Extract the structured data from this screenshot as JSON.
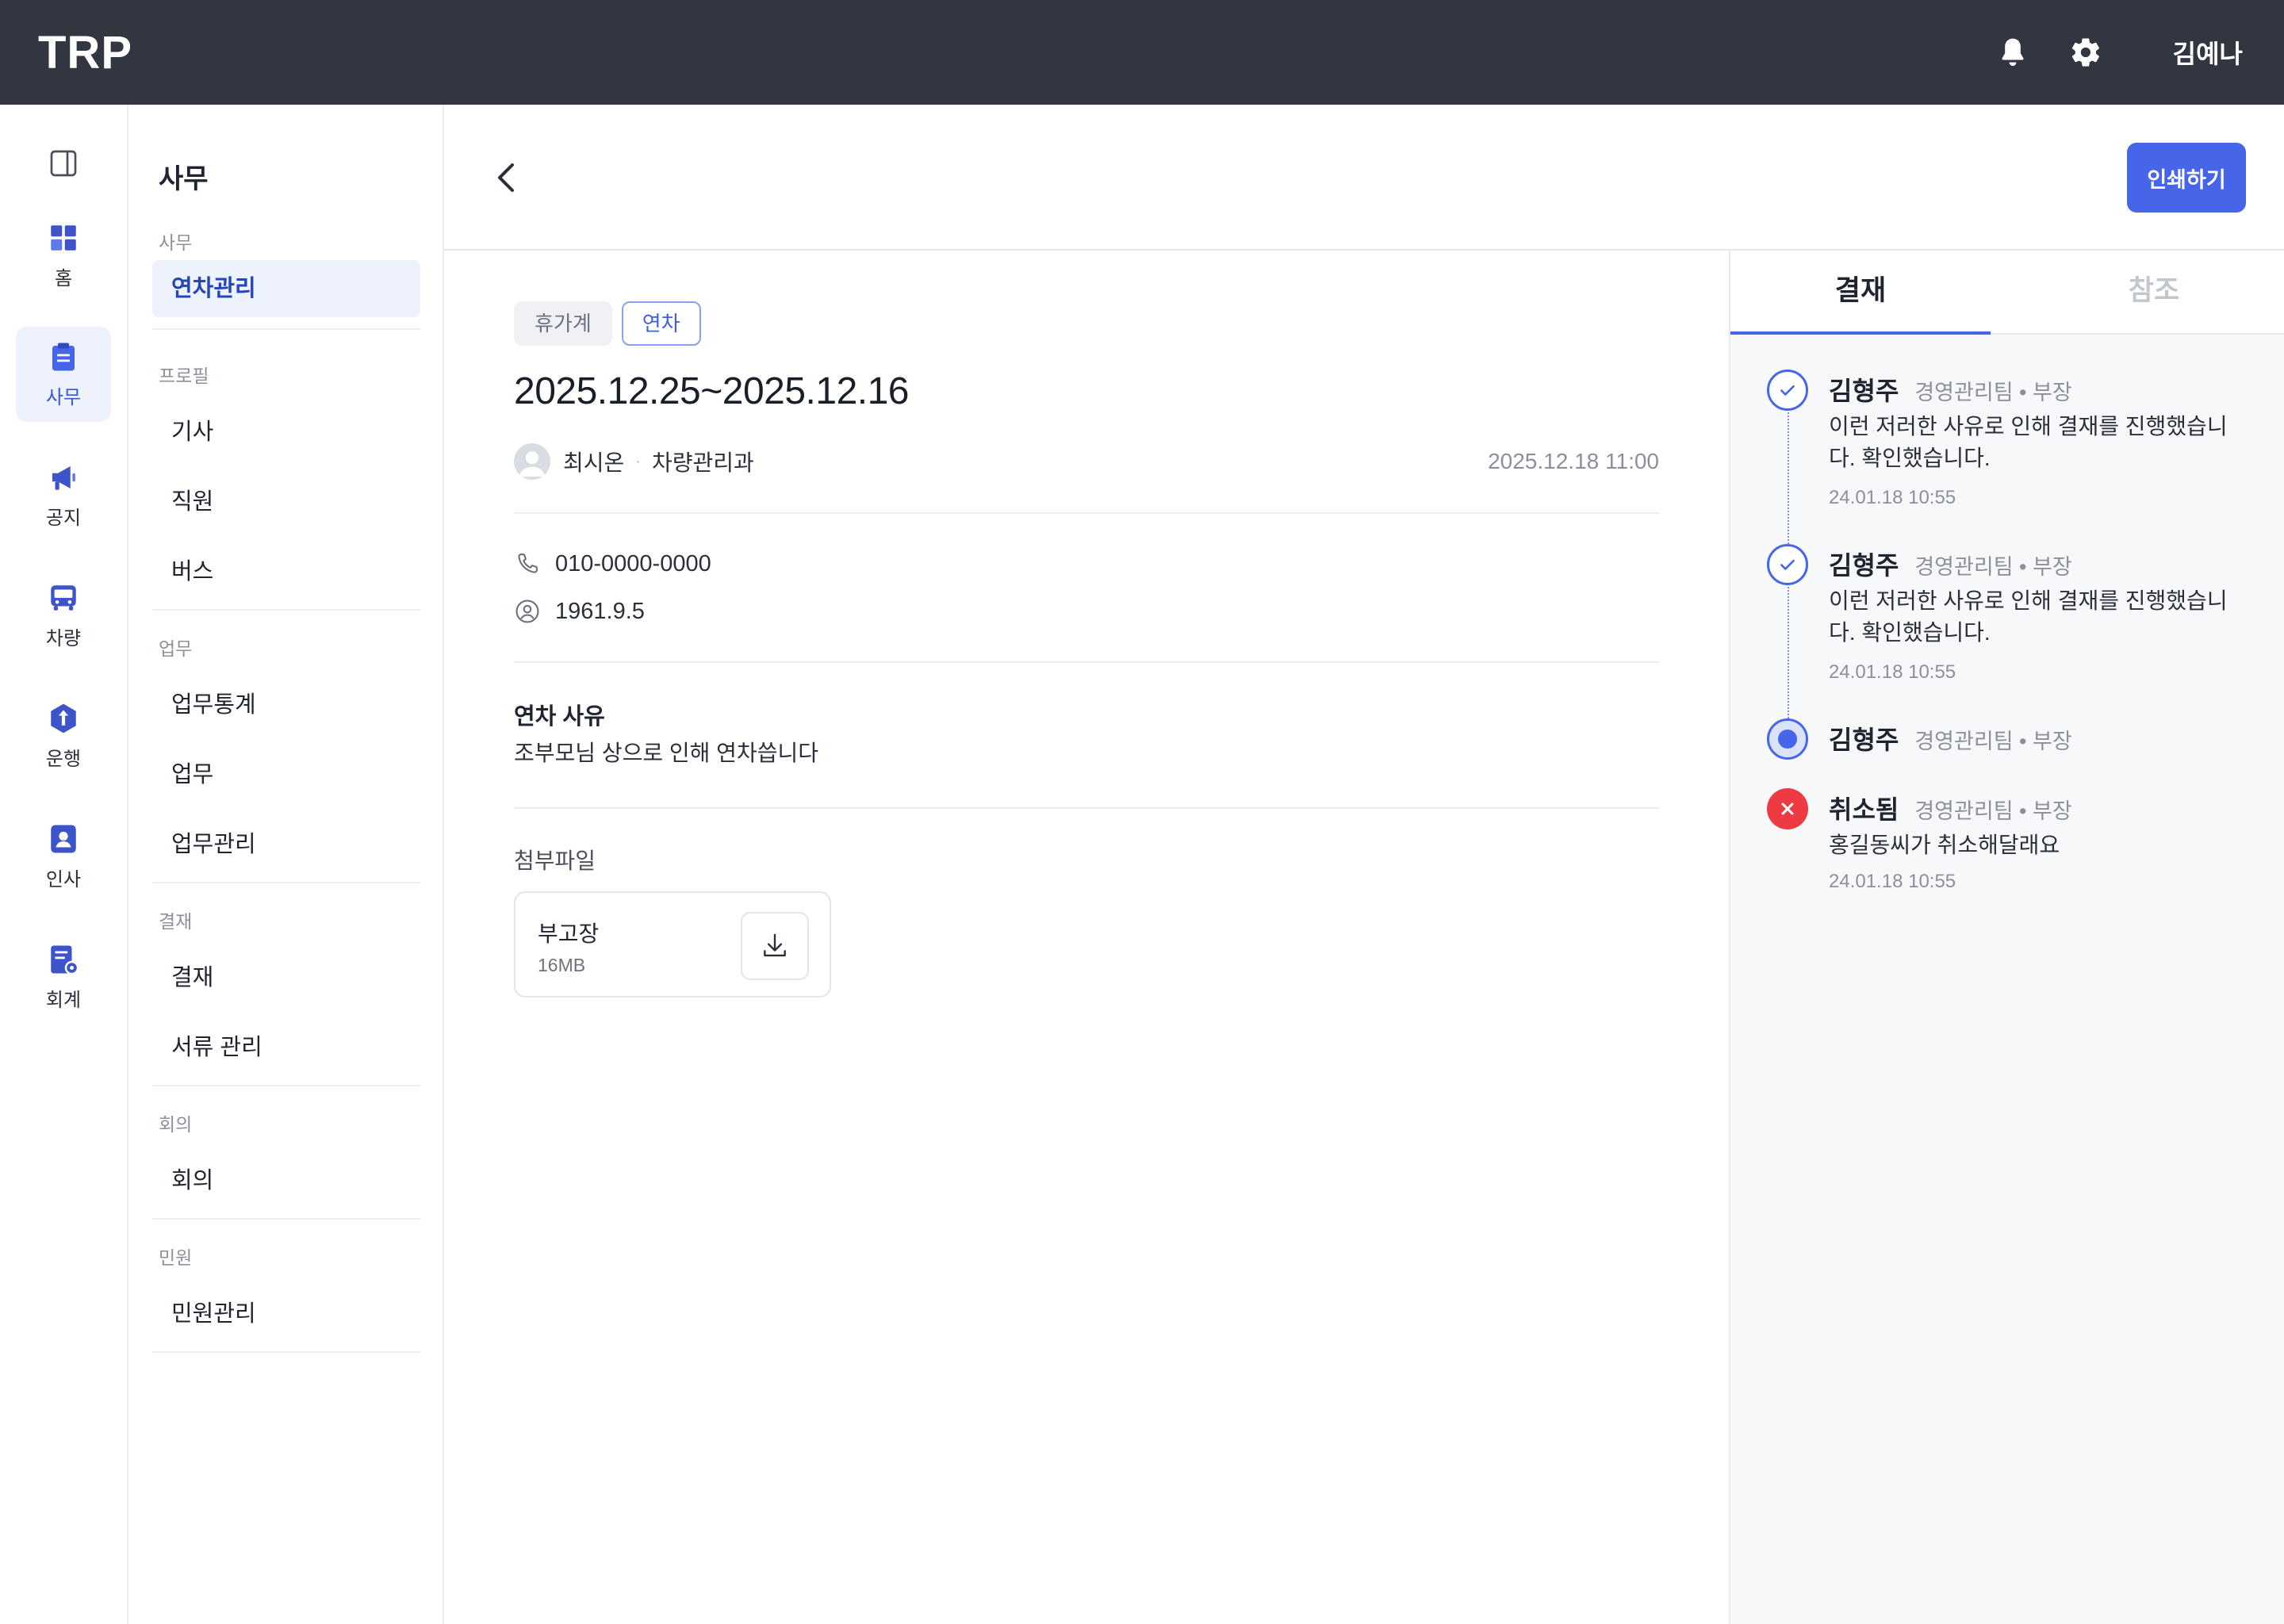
{
  "app": {
    "logo": "TRP",
    "user_name": "김예나",
    "icons": {
      "notifications": "bell-icon",
      "settings": "gear-icon"
    }
  },
  "rail": {
    "items": [
      {
        "label": "홈",
        "icon": "grid-icon"
      },
      {
        "label": "사무",
        "icon": "clipboard-icon",
        "active": true
      },
      {
        "label": "공지",
        "icon": "megaphone-icon"
      },
      {
        "label": "차량",
        "icon": "bus-icon"
      },
      {
        "label": "운행",
        "icon": "arrow-hexagon-icon"
      },
      {
        "label": "인사",
        "icon": "person-card-icon"
      },
      {
        "label": "회계",
        "icon": "document-gear-icon"
      }
    ]
  },
  "submenu": {
    "title": "사무",
    "sections": [
      {
        "label": "사무",
        "items": [
          "연차관리"
        ]
      },
      {
        "label": "프로필",
        "items": [
          "기사",
          "직원",
          "버스"
        ]
      },
      {
        "label": "업무",
        "items": [
          "업무통계",
          "업무",
          "업무관리"
        ]
      },
      {
        "label": "결재",
        "items": [
          "결재",
          "서류 관리"
        ]
      },
      {
        "label": "회의",
        "items": [
          "회의"
        ]
      },
      {
        "label": "민원",
        "items": [
          "민원관리"
        ]
      }
    ],
    "active_item": "연차관리"
  },
  "header": {
    "print_label": "인쇄하기"
  },
  "document": {
    "tags": [
      "휴가계",
      "연차"
    ],
    "date_range": "2025.12.25~2025.12.16",
    "author": {
      "name": "최시온",
      "dept": "차량관리과",
      "separator": "·",
      "created_at": "2025.12.18 11:00"
    },
    "phone": "010-0000-0000",
    "birth": "1961.9.5",
    "reason_title": "연차 사유",
    "reason_text": "조부모님 상으로 인해 연차씁니다",
    "attachments_title": "첨부파일",
    "file": {
      "name": "부고장",
      "size": "16MB"
    }
  },
  "side": {
    "tabs": [
      "결재",
      "참조"
    ],
    "active_tab": "결재",
    "timeline": [
      {
        "status": "approved",
        "name": "김형주",
        "meta": "경영관리팀 • 부장",
        "comment": "이런 저러한 사유로 인해 결재를 진행했습니다. 확인했습니다.",
        "time": "24.01.18 10:55"
      },
      {
        "status": "approved",
        "name": "김형주",
        "meta": "경영관리팀 • 부장",
        "comment": "이런 저러한 사유로 인해 결재를 진행했습니다. 확인했습니다.",
        "time": "24.01.18 10:55"
      },
      {
        "status": "current",
        "name": "김형주",
        "meta": "경영관리팀 • 부장",
        "comment": "",
        "time": ""
      },
      {
        "status": "canceled",
        "name": "취소됨",
        "meta": "경영관리팀 • 부장",
        "comment": "홍길동씨가 취소해달래요",
        "time": "24.01.18 10:55"
      }
    ]
  },
  "colors": {
    "accent": "#4665e8",
    "topbar": "#323641",
    "cancel": "#ee3b43"
  }
}
